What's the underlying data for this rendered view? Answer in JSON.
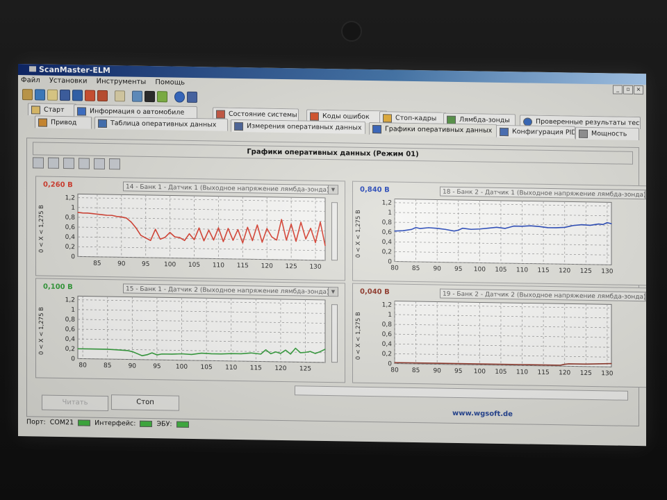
{
  "window": {
    "title": "ScanMaster-ELM"
  },
  "menu": [
    "Файл",
    "Установки",
    "Инструменты",
    "Помощь"
  ],
  "tabs_row1": [
    {
      "label": "Старт",
      "icon": "check-icon"
    },
    {
      "label": "Информация о автомобиле",
      "icon": "info-icon"
    },
    {
      "label": "Состояние системы",
      "icon": "system-status-icon"
    },
    {
      "label": "Коды ошибок",
      "icon": "warning-icon"
    },
    {
      "label": "Стоп-кадры",
      "icon": "freeze-frame-icon"
    },
    {
      "label": "Лямбда-зонды",
      "icon": "lambda-icon"
    },
    {
      "label": "Проверенные результаты теста",
      "icon": "test-results-icon"
    }
  ],
  "tabs_row2": [
    {
      "label": "Привод",
      "icon": "drive-icon"
    },
    {
      "label": "Таблица оперативных данных",
      "icon": "table-icon"
    },
    {
      "label": "Измерения оперативных данных",
      "icon": "measure-icon"
    },
    {
      "label": "Графики оперативных данных",
      "icon": "graph-icon"
    },
    {
      "label": "Конфигурация PID",
      "icon": "pid-config-icon"
    },
    {
      "label": "Мощность",
      "icon": "power-icon"
    }
  ],
  "panel": {
    "title": "Графики оперативных данных (Режим 01)"
  },
  "y_axis_label": "0 < X < 1,275 В",
  "charts": [
    {
      "value": "0,260 В",
      "color": "#d6392a",
      "sensor": "14 - Банк 1 - Датчик 1 (Выходное напряжение лямбда-зонда)",
      "chart_data": {
        "type": "line",
        "yticks": [
          "0",
          "0,2",
          "0,4",
          "0,6",
          "0,8",
          "1",
          "1,2"
        ],
        "xticks": [
          "85",
          "90",
          "95",
          "100",
          "105",
          "110",
          "115",
          "120",
          "125",
          "130"
        ],
        "ylim": [
          0,
          1.275
        ],
        "xlim": [
          81,
          132
        ],
        "x": [
          81,
          82,
          83,
          84,
          85,
          86,
          87,
          88,
          89,
          90,
          91,
          92,
          93,
          94,
          95,
          96,
          97,
          98,
          99,
          100,
          101,
          102,
          103,
          104,
          105,
          106,
          107,
          108,
          109,
          110,
          111,
          112,
          113,
          114,
          115,
          116,
          117,
          118,
          119,
          120,
          121,
          122,
          123,
          124,
          125,
          126,
          127,
          128,
          129,
          130,
          131,
          132
        ],
        "values": [
          0.9,
          0.89,
          0.89,
          0.88,
          0.87,
          0.86,
          0.85,
          0.85,
          0.83,
          0.82,
          0.8,
          0.72,
          0.6,
          0.45,
          0.4,
          0.35,
          0.58,
          0.38,
          0.42,
          0.52,
          0.43,
          0.42,
          0.36,
          0.5,
          0.38,
          0.62,
          0.36,
          0.58,
          0.38,
          0.63,
          0.35,
          0.62,
          0.38,
          0.6,
          0.33,
          0.65,
          0.38,
          0.7,
          0.35,
          0.63,
          0.46,
          0.4,
          0.82,
          0.4,
          0.73,
          0.38,
          0.77,
          0.43,
          0.65,
          0.36,
          0.78,
          0.3
        ]
      }
    },
    {
      "value": "0,840 В",
      "color": "#1c3fb4",
      "sensor": "18 - Банк 2 - Датчик 1 (Выходное напряжение лямбда-зонда)",
      "chart_data": {
        "type": "line",
        "yticks": [
          "0",
          "0,2",
          "0,4",
          "0,6",
          "0,8",
          "1",
          "1,2"
        ],
        "xticks": [
          "80",
          "85",
          "90",
          "95",
          "100",
          "105",
          "110",
          "115",
          "120",
          "125",
          "130"
        ],
        "ylim": [
          0,
          1.275
        ],
        "xlim": [
          80,
          131
        ],
        "x": [
          80,
          82,
          84,
          85,
          86,
          88,
          90,
          92,
          94,
          95,
          96,
          98,
          100,
          102,
          104,
          106,
          108,
          110,
          112,
          114,
          116,
          118,
          120,
          122,
          124,
          126,
          128,
          129,
          130,
          131
        ],
        "values": [
          0.62,
          0.63,
          0.66,
          0.7,
          0.68,
          0.7,
          0.69,
          0.67,
          0.64,
          0.66,
          0.7,
          0.68,
          0.69,
          0.71,
          0.73,
          0.71,
          0.76,
          0.76,
          0.77,
          0.76,
          0.74,
          0.74,
          0.75,
          0.79,
          0.81,
          0.8,
          0.83,
          0.82,
          0.86,
          0.84
        ]
      }
    },
    {
      "value": "0,100 В",
      "color": "#2f9b37",
      "sensor": "15 - Банк 1 - Датчик 2 (Выходное напряжение лямбда-зонда)",
      "chart_data": {
        "type": "line",
        "yticks": [
          "0",
          "0,2",
          "0,4",
          "0,6",
          "0,8",
          "1",
          "1,2"
        ],
        "xticks": [
          "80",
          "85",
          "90",
          "95",
          "100",
          "105",
          "110",
          "115",
          "120",
          "125"
        ],
        "ylim": [
          0,
          1.275
        ],
        "xlim": [
          79,
          129
        ],
        "x": [
          79,
          81,
          83,
          85,
          87,
          89,
          90,
          91,
          92,
          93,
          94,
          95,
          96,
          98,
          100,
          102,
          104,
          106,
          108,
          110,
          112,
          114,
          116,
          117,
          118,
          119,
          120,
          121,
          122,
          123,
          124,
          125,
          126,
          127,
          128,
          129
        ],
        "values": [
          0.2,
          0.2,
          0.2,
          0.2,
          0.19,
          0.18,
          0.16,
          0.12,
          0.08,
          0.1,
          0.14,
          0.1,
          0.12,
          0.12,
          0.13,
          0.12,
          0.15,
          0.14,
          0.14,
          0.15,
          0.15,
          0.17,
          0.15,
          0.24,
          0.16,
          0.2,
          0.17,
          0.24,
          0.16,
          0.28,
          0.19,
          0.2,
          0.22,
          0.18,
          0.22,
          0.27
        ]
      }
    },
    {
      "value": "0,040 В",
      "color": "#8a2e20",
      "sensor": "19 - Банк 2 - Датчик 2 (Выходное напряжение лямбда-зонда)",
      "chart_data": {
        "type": "line",
        "yticks": [
          "0",
          "0,2",
          "0,4",
          "0,6",
          "0,8",
          "1",
          "1,2"
        ],
        "xticks": [
          "80",
          "85",
          "90",
          "95",
          "100",
          "105",
          "110",
          "115",
          "120",
          "125",
          "130"
        ],
        "ylim": [
          0,
          1.275
        ],
        "xlim": [
          80,
          131
        ],
        "x": [
          80,
          90,
          100,
          110,
          119,
          120,
          121,
          125,
          128,
          131
        ],
        "values": [
          0.02,
          0.02,
          0.02,
          0.02,
          0.02,
          0.04,
          0.05,
          0.05,
          0.06,
          0.07
        ]
      }
    }
  ],
  "buttons": {
    "read": "Читать",
    "stop": "Стоп"
  },
  "url": "www.wgsoft.de",
  "status": {
    "port_label": "Порт:",
    "port_value": "COM21",
    "interface_label": "Интерфейс:",
    "ecu_label": "ЭБУ:"
  }
}
